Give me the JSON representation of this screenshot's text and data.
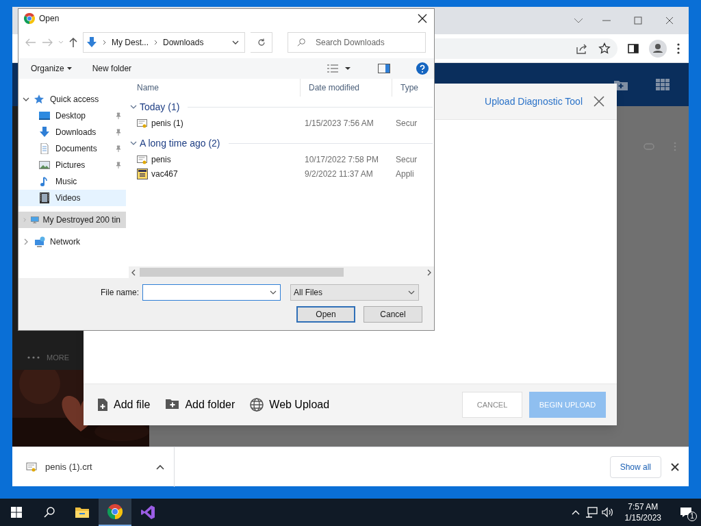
{
  "browser": {
    "page_sidebar": {
      "more": "MORE"
    },
    "download_bar": {
      "file": "penis (1).crt",
      "show_all": "Show all"
    }
  },
  "upload_modal": {
    "title": "Upload Diagnostic Tool",
    "actions": [
      {
        "label": "Add file",
        "kind": "file"
      },
      {
        "label": "Add folder",
        "kind": "folder"
      },
      {
        "label": "Web Upload",
        "kind": "globe"
      }
    ],
    "cancel": {
      "label": "CANCEL",
      "disabled": false
    },
    "begin_upload": {
      "label": "BEGIN UPLOAD",
      "disabled": true
    }
  },
  "dialog": {
    "title": "Open",
    "breadcrumb": [
      "My Dest...",
      "Downloads"
    ],
    "search": {
      "placeholder": "Search Downloads"
    },
    "toolbar": {
      "organize": "Organize",
      "new_folder": "New folder"
    },
    "nav": [
      {
        "label": "Quick access",
        "kind": "star",
        "expanded": true,
        "selected": false,
        "hovered": false,
        "children": [
          {
            "label": "Desktop",
            "kind": "desktop",
            "pinned": true,
            "selected": false,
            "hovered": false
          },
          {
            "label": "Downloads",
            "kind": "download",
            "pinned": true,
            "selected": false,
            "hovered": false
          },
          {
            "label": "Documents",
            "kind": "document",
            "pinned": true,
            "selected": false,
            "hovered": false
          },
          {
            "label": "Pictures",
            "kind": "pictures",
            "pinned": true,
            "selected": false,
            "hovered": false
          },
          {
            "label": "Music",
            "kind": "music",
            "pinned": false,
            "selected": false,
            "hovered": false
          },
          {
            "label": "Videos",
            "kind": "video",
            "pinned": false,
            "selected": false,
            "hovered": true
          }
        ]
      },
      {
        "label": "My Destroyed 200 tin",
        "kind": "computer",
        "expanded": false,
        "selected": true,
        "hovered": false
      },
      {
        "label": "Network",
        "kind": "network",
        "expanded": false,
        "selected": false,
        "hovered": false
      }
    ],
    "columns": [
      "Name",
      "Date modified",
      "Type"
    ],
    "groups": [
      {
        "label": "Today (1)",
        "expanded": true,
        "files": [
          {
            "name": "penis (1)",
            "date": "1/15/2023 7:56 AM",
            "type": "Secur",
            "kind": "certificate"
          }
        ]
      },
      {
        "label": "A long time ago (2)",
        "expanded": true,
        "files": [
          {
            "name": "penis",
            "date": "10/17/2022 7:58 PM",
            "type": "Secur",
            "kind": "certificate"
          },
          {
            "name": "vac467",
            "date": "9/2/2022 11:37 AM",
            "type": "Appli",
            "kind": "application"
          }
        ]
      }
    ],
    "file_name_label": "File name:",
    "file_type": "All Files",
    "buttons": [
      "Open",
      "Cancel"
    ]
  },
  "taskbar": {
    "time": "7:57 AM",
    "date": "1/15/2023",
    "notifications": "1"
  }
}
